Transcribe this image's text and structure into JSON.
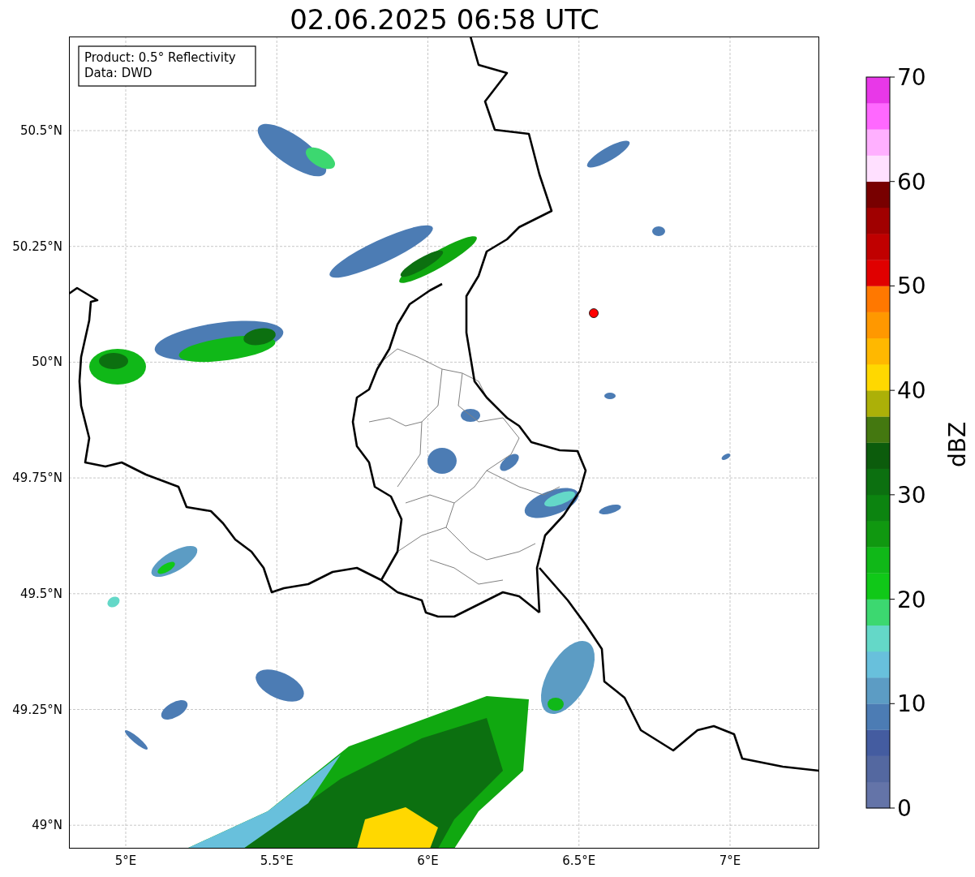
{
  "title": "02.06.2025 06:58 UTC",
  "legend": [
    "Product: 0.5° Reflectivity",
    "Data: DWD"
  ],
  "map": {
    "xticks": [
      "5°E",
      "5.5°E",
      "6°E",
      "6.5°E",
      "7°E"
    ],
    "yticks": [
      "50.5°N",
      "50.25°N",
      "50°N",
      "49.75°N",
      "49.5°N",
      "49.25°N",
      "49°N"
    ]
  },
  "colorbar": {
    "label": "dBZ",
    "ticks": [
      "70",
      "60",
      "50",
      "40",
      "30",
      "20",
      "10",
      "0"
    ],
    "bands": [
      {
        "color": "#6474a8"
      },
      {
        "color": "#5468a0"
      },
      {
        "color": "#445ca0"
      },
      {
        "color": "#4c7cb4"
      },
      {
        "color": "#5c9cc4"
      },
      {
        "color": "#68c0dc"
      },
      {
        "color": "#64d8c8"
      },
      {
        "color": "#3cd870"
      },
      {
        "color": "#10c818"
      },
      {
        "color": "#10b818"
      },
      {
        "color": "#109810"
      },
      {
        "color": "#0c8410"
      },
      {
        "color": "#0c7010"
      },
      {
        "color": "#0c5c0c"
      },
      {
        "color": "#447810"
      },
      {
        "color": "#acb008"
      },
      {
        "color": "#ffd800"
      },
      {
        "color": "#ffb800"
      },
      {
        "color": "#ff9800"
      },
      {
        "color": "#ff7800"
      },
      {
        "color": "#e00000"
      },
      {
        "color": "#c00000"
      },
      {
        "color": "#a00000"
      },
      {
        "color": "#780000"
      },
      {
        "color": "#ffe0ff"
      },
      {
        "color": "#ffb0ff"
      },
      {
        "color": "#ff68ff"
      },
      {
        "color": "#e838e8"
      }
    ]
  }
}
